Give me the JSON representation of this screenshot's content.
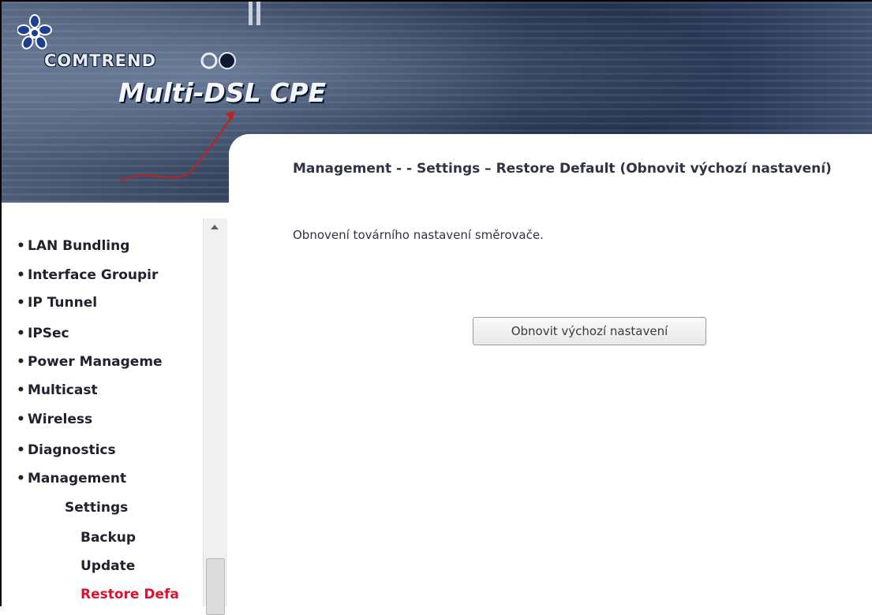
{
  "header": {
    "brand": "COMTREND",
    "product": "Multi-DSL CPE"
  },
  "main": {
    "title": "Management - - Settings – Restore Default (Obnovit výchozí nastavení)",
    "description": "Obnovení továrního nastavení směrovače.",
    "restore_button_label": "Obnovit výchozí nastavení"
  },
  "sidebar": {
    "items": [
      {
        "label": "LAN Bundling",
        "bullet": "•",
        "level": 0
      },
      {
        "label": "Interface Groupir",
        "bullet": "•",
        "level": 0
      },
      {
        "label": "IP Tunnel",
        "bullet": "•",
        "level": 0
      },
      {
        "label": "IPSec",
        "bullet": "•",
        "level": 0
      },
      {
        "label": "Power Manageme",
        "bullet": "•",
        "level": 0
      },
      {
        "label": "Multicast",
        "bullet": "•",
        "level": 0
      },
      {
        "label": "Wireless",
        "bullet": "•",
        "level": 0
      },
      {
        "label": "Diagnostics",
        "bullet": "•",
        "level": 0
      },
      {
        "label": "Management",
        "bullet": "•",
        "level": 0
      },
      {
        "label": "Settings",
        "level": 1
      },
      {
        "label": "Backup",
        "level": 2
      },
      {
        "label": "Update",
        "level": 2
      },
      {
        "label": "Restore Defa",
        "level": 2,
        "active": true
      }
    ]
  },
  "colors": {
    "active_link": "#e0102c",
    "text": "#2f3342",
    "banner": "#2b3a55"
  },
  "icons": [
    "comtrend-logo-icon",
    "bullet-icon",
    "scroll-up-icon"
  ]
}
